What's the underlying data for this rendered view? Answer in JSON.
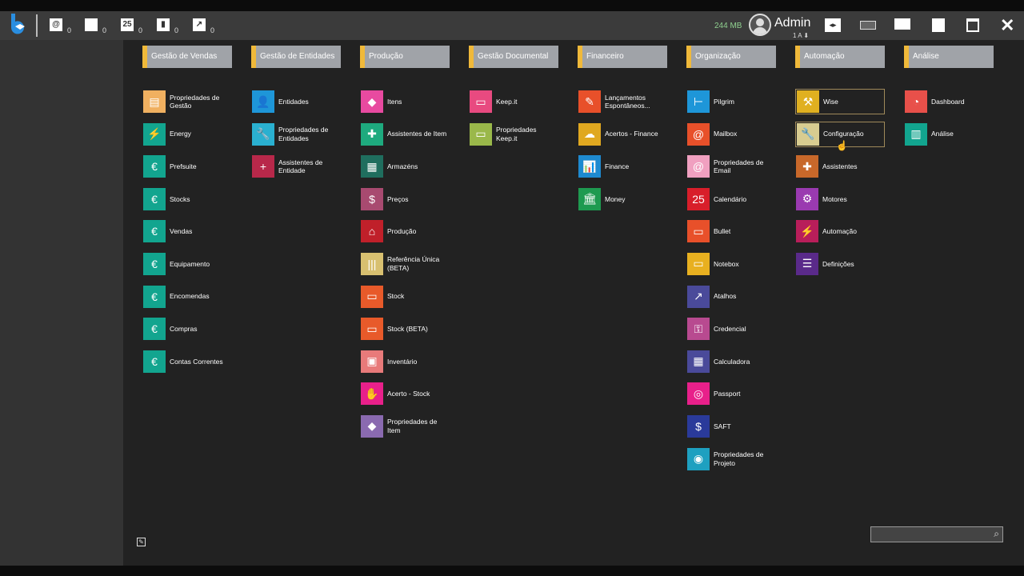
{
  "toolbar": {
    "counters": [
      {
        "icon": "at-icon",
        "glyph": "@",
        "count": "0"
      },
      {
        "icon": "window-icon",
        "glyph": "",
        "count": "0"
      },
      {
        "icon": "calendar-icon",
        "glyph": "25",
        "count": "0"
      },
      {
        "icon": "bullet-icon",
        "glyph": "▮",
        "count": "0"
      },
      {
        "icon": "shortcut-icon",
        "glyph": "↗",
        "count": "0"
      }
    ],
    "memory": "244 MB",
    "user": "Admin",
    "user_sub": "1 A ⬇"
  },
  "columns": [
    {
      "title": "Gestão de Vendas",
      "items": [
        {
          "label": "Propriedades de Gestão",
          "color": "#f0b060",
          "glyph": "▤"
        },
        {
          "label": "Energy",
          "color": "#12a58f",
          "glyph": "⚡"
        },
        {
          "label": "Prefsuite",
          "color": "#12a58f",
          "glyph": "€"
        },
        {
          "label": "Stocks",
          "color": "#12a58f",
          "glyph": "€"
        },
        {
          "label": "Vendas",
          "color": "#12a58f",
          "glyph": "€"
        },
        {
          "label": "Equipamento",
          "color": "#12a58f",
          "glyph": "€"
        },
        {
          "label": "Encomendas",
          "color": "#12a58f",
          "glyph": "€"
        },
        {
          "label": "Compras",
          "color": "#12a58f",
          "glyph": "€"
        },
        {
          "label": "Contas Correntes",
          "color": "#12a58f",
          "glyph": "€"
        }
      ]
    },
    {
      "title": "Gestão de Entidades",
      "items": [
        {
          "label": "Entidades",
          "color": "#1e96d8",
          "glyph": "👤"
        },
        {
          "label": "Propriedades de Entidades",
          "color": "#2ab0d0",
          "glyph": "🔧"
        },
        {
          "label": "Assistentes de Entidade",
          "color": "#b8284a",
          "glyph": "+"
        }
      ]
    },
    {
      "title": "Produção",
      "items": [
        {
          "label": "Itens",
          "color": "#e84aa0",
          "glyph": "◆"
        },
        {
          "label": "Assistentes de Item",
          "color": "#1eaa7e",
          "glyph": "✚"
        },
        {
          "label": "Armazéns",
          "color": "#1f6e5e",
          "glyph": "▦"
        },
        {
          "label": "Preços",
          "color": "#a84a70",
          "glyph": "$"
        },
        {
          "label": "Produção",
          "color": "#c0202a",
          "glyph": "⌂"
        },
        {
          "label": "Referência Única (BETA)",
          "color": "#d8c070",
          "glyph": "|||"
        },
        {
          "label": "Stock",
          "color": "#e85a2a",
          "glyph": "▭"
        },
        {
          "label": "Stock (BETA)",
          "color": "#e85a2a",
          "glyph": "▭"
        },
        {
          "label": "Inventário",
          "color": "#e87a7a",
          "glyph": "▣"
        },
        {
          "label": "Acerto - Stock",
          "color": "#e8208a",
          "glyph": "✋"
        },
        {
          "label": "Propriedades de Item",
          "color": "#8a6ab0",
          "glyph": "◆"
        }
      ]
    },
    {
      "title": "Gestão Documental",
      "items": [
        {
          "label": "Keep.it",
          "color": "#e84a80",
          "glyph": "▭"
        },
        {
          "label": "Propriedades Keep.it",
          "color": "#9ab84a",
          "glyph": "▭"
        }
      ]
    },
    {
      "title": "Financeiro",
      "items": [
        {
          "label": "Lançamentos Espontâneos...",
          "color": "#e8502a",
          "glyph": "✎"
        },
        {
          "label": "Acertos - Finance",
          "color": "#e0a820",
          "glyph": "☁"
        },
        {
          "label": "Finance",
          "color": "#1e8ad0",
          "glyph": "📊"
        },
        {
          "label": "Money",
          "color": "#1e9a50",
          "glyph": "🏛"
        }
      ]
    },
    {
      "title": "Organização",
      "items": [
        {
          "label": "Pilgrim",
          "color": "#1e96d8",
          "glyph": "⊢"
        },
        {
          "label": "Mailbox",
          "color": "#e8502a",
          "glyph": "@"
        },
        {
          "label": "Propriedades de Email",
          "color": "#f0a0c0",
          "glyph": "@"
        },
        {
          "label": "Calendário",
          "color": "#d81e2a",
          "glyph": "25"
        },
        {
          "label": "Bullet",
          "color": "#e8502a",
          "glyph": "▭"
        },
        {
          "label": "Notebox",
          "color": "#e8b020",
          "glyph": "▭"
        },
        {
          "label": "Atalhos",
          "color": "#4a4a9a",
          "glyph": "↗"
        },
        {
          "label": "Credencial",
          "color": "#b84a90",
          "glyph": "⚿"
        },
        {
          "label": "Calculadora",
          "color": "#4a4a9a",
          "glyph": "▦"
        },
        {
          "label": "Passport",
          "color": "#e8208a",
          "glyph": "◎"
        },
        {
          "label": "SAFT",
          "color": "#2a3a9a",
          "glyph": "$"
        },
        {
          "label": "Propriedades de Projeto",
          "color": "#1ea0c0",
          "glyph": "◉"
        }
      ]
    },
    {
      "title": "Automação",
      "items": [
        {
          "label": "Wise",
          "color": "#e0b020",
          "glyph": "⚒",
          "selected": true
        },
        {
          "label": "Configuração",
          "color": "#d8cc90",
          "glyph": "🔧",
          "selected": true
        },
        {
          "label": "Assistentes",
          "color": "#c8682a",
          "glyph": "✚"
        },
        {
          "label": "Motores",
          "color": "#9a3ab0",
          "glyph": "⚙"
        },
        {
          "label": "Automação",
          "color": "#b81e5a",
          "glyph": "⚡"
        },
        {
          "label": "Definições",
          "color": "#5a2a8a",
          "glyph": "☰"
        }
      ]
    },
    {
      "title": "Análise",
      "items": [
        {
          "label": "Dashboard",
          "color": "#e8504a",
          "glyph": "◔"
        },
        {
          "label": "Análise",
          "color": "#12a58f",
          "glyph": "▥"
        }
      ]
    }
  ],
  "search": {
    "placeholder": ""
  }
}
